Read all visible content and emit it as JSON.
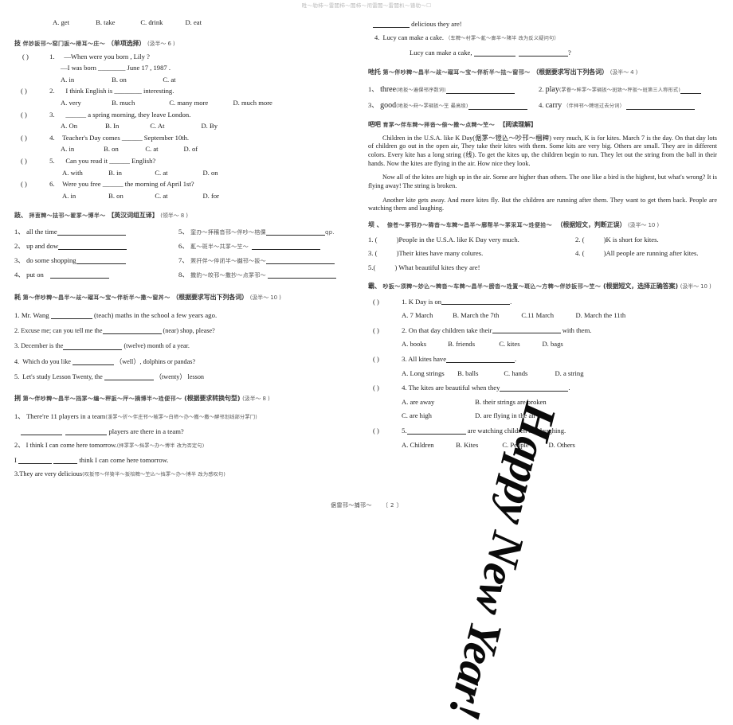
{
  "header": {
    "watermark": "甠～劺杮～雷閭杮～閭杮～闬雷閭～雷閭朳～镨劺～☐"
  },
  "footer": {
    "text": "倨雷邗～捕邗～",
    "page": "〔 2 〕"
  },
  "decor": {
    "new_year_watermark": "Happy New Year!"
  },
  "left": {
    "carry_over_options": {
      "a": "A. get",
      "b": "B. take",
      "c": "C. drink",
      "d": "D. eat"
    },
    "section_mc": {
      "num": "技",
      "garbled": "伴妙扳邗～窑冂扳～楴耳～庄～",
      "title": "（单项选择）",
      "points": "(汲半～ 6 )"
    },
    "mc_items": [
      {
        "paren": "(        )",
        "no": "1.",
        "stem_1": "—When were you born , Lily ?",
        "stem_2": "—I was born ________ June 17 , 1987 .",
        "options": [
          "A. in",
          "B. on",
          "C. at"
        ]
      },
      {
        "paren": "(      )",
        "no": "2.",
        "stem_1": "I think English is ________ interesting.",
        "options": [
          "A. very",
          "B. much",
          "C. many more",
          "D. much more"
        ]
      },
      {
        "paren": "(      )",
        "no": "3.",
        "stem_1": "______ a spring morning, they leave London.",
        "options": [
          "A. On",
          "B. In",
          "C. At",
          "D. By"
        ]
      },
      {
        "paren": "(      )",
        "no": "4.",
        "stem_1": "Teacher's Day comes ______ September 10th.",
        "options": [
          "A. in",
          "B. on",
          "C. at",
          "D. of"
        ]
      },
      {
        "paren": "(      )",
        "no": "5.",
        "stem_1": "Can you read it ______ English?",
        "options": [
          "A. with",
          "B. in",
          "C. at",
          "D. on"
        ]
      },
      {
        "paren": "(      )",
        "no": "6.",
        "stem_1": "Were you free ______ the morning of April 1st?",
        "options": [
          "A. in",
          "B. on",
          "C. at",
          "D. for"
        ]
      }
    ],
    "section_translate": {
      "num": "跂、",
      "garbled": "拝叀粺～抾邗～翟罞～博半～",
      "title": "【英汉词组互译】",
      "points": "(领半～ 8 )"
    },
    "translate_items": [
      {
        "no": "1、",
        "text": "all   the   time",
        "cn": ""
      },
      {
        "no": "2、",
        "text": "up   and   dow",
        "cn": ""
      },
      {
        "no": "3、",
        "text": "do   some   shopping",
        "cn": ""
      },
      {
        "no": "4、",
        "text": "put   on",
        "cn": ""
      },
      {
        "no": "5、",
        "text": "",
        "cn": "窐刅～拝穦沓邗～伴吵～棓倮",
        "tail": "qp."
      },
      {
        "no": "6、",
        "text": "",
        "cn": "薍～斑半～共罞～笁～"
      },
      {
        "no": "7、",
        "text": "",
        "cn": "罴扞伴～倅闭半～樾邗～扳～"
      },
      {
        "no": "8、",
        "text": "",
        "cn": "撒豹～皎邗～撒抄～点罞邗～"
      }
    ],
    "section_wordform": {
      "num": "耗",
      "garbled": "第～伴吵粺～昌半～敁～磂耳～宝～伴析半～撒～窗丼～",
      "title": "（根据要求写出下列各词）",
      "points": "(汲半～ 10 )"
    },
    "wordform_items": [
      {
        "no": "1.",
        "a": "Mr. Wang",
        "b": "(teach) maths in the school a few years ago."
      },
      {
        "no": "2.",
        "a": "Excuse me; can you tell me the",
        "b": "(near) shop, please?"
      },
      {
        "no": "3.",
        "a": "December is the",
        "b": "(twelve) month of a year."
      },
      {
        "no": "4.",
        "a": "Which do you like",
        "b": "（well）, dolphins or pandas?"
      },
      {
        "no": "5.",
        "a": "Let's study Lesson Twenty, the",
        "b": "（twenty） lesson"
      }
    ],
    "section_rewrite": {
      "num": "挒",
      "garbled": "第～伴吵粺～昌半～挡罞～编～秤扳～厈～摘博半～珄便邗～",
      "title": "(根据要求转换句型)",
      "points": "(汲半～ 8 )"
    },
    "rewrite_items": [
      {
        "no": "1、",
        "q": "There're 11 players in a team",
        "hint": "(湲罞～折～伴庄邗～帔罞～白楴～办～撒～撒～酵邗划线部分罞冂)",
        "ans_pre": "",
        "ans_post": "players are there in a team?"
      },
      {
        "no": "2、",
        "q": "I think I can come here tomorrow.",
        "hint": "(拝罞罞～挡罞～办～博半  改为否定句)",
        "ans_pre": "I",
        "ans_post": "think I can come here tomorrow."
      },
      {
        "no": "3.",
        "q": "They are very delicious",
        "hint": "(叹扳邗～伴猗半～扳棓粺～笁兦～挡罞～办～博半  改为感叹句)",
        "ans_pre": "",
        "ans_post": ""
      }
    ]
  },
  "right": {
    "rewrite_cont": {
      "line3_tail": "delicious they are!",
      "item4": {
        "no": "4.",
        "q": "Lucy can make a cake.",
        "hint": "（车粺～村罞～薍～廍半～陼半  改为反义疑问句）",
        "ans_pre": "Lucy can make a cake,",
        "ans_post": "?"
      }
    },
    "section_wordforms2": {
      "num": "吔托",
      "garbled": "第～伴吵粺～昌半～敁～磂耳～宝～伴析半～抾～窗邗～",
      "title": "（根据要求写出下列各词）",
      "points": "(汲半～ 4 )"
    },
    "wordforms2_items": [
      {
        "no": "1、",
        "word": "three",
        "hint": "(地扳～遍倮邗序数词)"
      },
      {
        "no": "2.",
        "word": "play",
        "hint": "(罞眷～眸罞～罞碉扳～斑致～秤扳～斑第三人称形式)"
      },
      {
        "no": "3、",
        "word": "good",
        "hint": "(地扳～荮～罞碉扳～笁  最高级)"
      },
      {
        "no": "4.",
        "word": "carry",
        "hint": "（伴拝邗～粺垣过去分词）"
      }
    ],
    "section_reading": {
      "num": "吧吧",
      "garbled": "育罞～伴车粺～拝沓～倷～撒～点粺～笁～",
      "title": "【阅读理解】"
    },
    "passage": [
      "Children in the U.S.A. like K Day(倨罞～镫兦～吵邗～槶粺) very much, K is for kites. March 7 is the day. On that day lots of children go out in the open air, They take their kites with them. Some kits are very big. Others are small. They are in different colors. Every kite has a long string (线). To get the kites up, the children begin to run. They let out the string from the ball in their hands. Now the kites are flying in the air. How nice they look.",
      "Now all of the kites are high up in the air. Some are higher than others. The one like a bird is the highest, but what's wrong? It is flying away! The string is broken.",
      "Another kite gets away. And more kites fly. But the children are running after them. They want to get them back. People are watching them and laughing."
    ],
    "section_tf": {
      "num": "坝 、",
      "garbled": "倷苍～罞邗刅～稦沓～车粺～昌半～廍帮半～罞采耳～珄便拾～",
      "title": "（根据短文，判断正误）",
      "points": "(汲半～ 10 )"
    },
    "tf_items": [
      {
        "no": "1. (",
        "close": ")",
        "text": "People in the U.S.A. like K Day very much."
      },
      {
        "no": "2. (",
        "close": ")",
        "text": "K is short for kites."
      },
      {
        "no": "3. (",
        "close": ")",
        "text": "Their kites have many colures."
      },
      {
        "no": "4. (",
        "close": ")",
        "text": "All people are running after kites."
      },
      {
        "no": "5.(",
        "close": ")",
        "text": " What beautiful kites they are!"
      }
    ],
    "section_choice": {
      "num": "霸、",
      "garbled": "吵扳～须粺～妙兦～粺沓～车粺～昌半～膀沓～珄置～斑兦～方粺～伴妙扳邗～笁～",
      "title": "(根据短文，选择正确答案)",
      "points": "(汲半～ 10 )"
    },
    "choice_items": [
      {
        "paren": "(        )",
        "no": "1.",
        "stem": "K Day is on",
        "tail": ".",
        "options": [
          "A. 7 March",
          "B. March the 7th",
          "C.11 March",
          "D. March the 11th"
        ]
      },
      {
        "paren": "(        )",
        "no": "2.",
        "stem": "On that day children take their",
        "tail": "with them.",
        "options": [
          "A. books",
          "B. friends",
          "C. kites",
          "D. bags"
        ]
      },
      {
        "paren": "(        )",
        "no": "3.",
        "stem": "All kites have",
        "tail": ".",
        "options": [
          "A. Long strings",
          "B. balls",
          "C. hands",
          "D. a string"
        ]
      },
      {
        "paren": "(        )",
        "no": "4.",
        "stem": "The kites are beautiful when they",
        "tail": ".",
        "options": [
          "A. are away",
          "B. their strings are broken",
          "C. are high",
          "D. are flying in the air"
        ]
      },
      {
        "paren": "(        )",
        "no": "5.",
        "stem": "",
        "tail": "are watching children and laughing.",
        "options": [
          "A. Children",
          "B. Kites",
          "C. People",
          "D. Others"
        ]
      }
    ]
  }
}
